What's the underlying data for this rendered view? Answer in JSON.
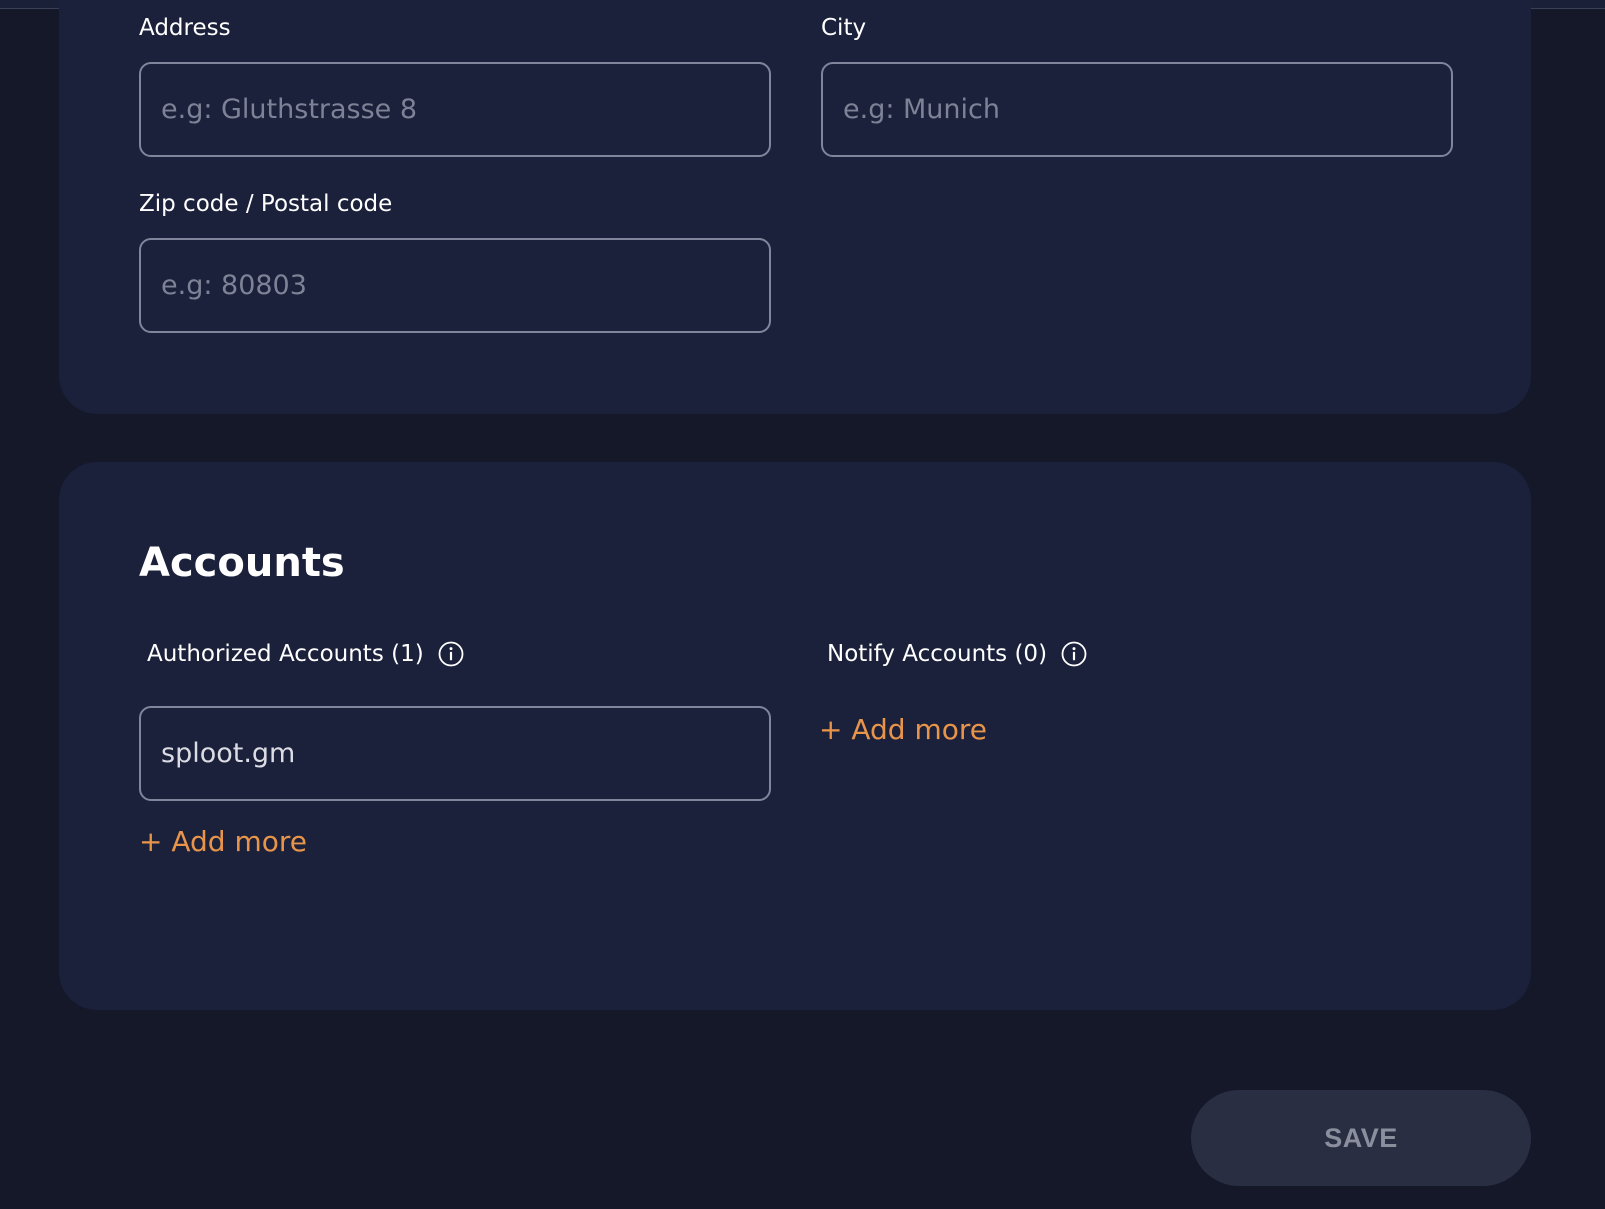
{
  "address_section": {
    "address": {
      "label": "Address",
      "value": "",
      "placeholder": "e.g: Gluthstrasse 8"
    },
    "city": {
      "label": "City",
      "value": "",
      "placeholder": "e.g: Munich"
    },
    "zip": {
      "label": "Zip code / Postal code",
      "value": "",
      "placeholder": "e.g: 80803"
    }
  },
  "accounts_section": {
    "title": "Accounts",
    "authorized": {
      "label": "Authorized Accounts (1)",
      "info_icon": "info-circle-icon",
      "entries": [
        "sploot.gm"
      ],
      "add_more_label": "+ Add more"
    },
    "notify": {
      "label": "Notify Accounts (0)",
      "info_icon": "info-circle-icon",
      "entries": [],
      "add_more_label": "+ Add more"
    }
  },
  "actions": {
    "save_label": "SAVE"
  },
  "colors": {
    "page_background": "#141829",
    "card_background": "#1b203b",
    "input_border": "#80859b",
    "accent": "#e8954a",
    "save_button_background": "#2a2e42",
    "save_button_text": "#8b8e9d"
  }
}
